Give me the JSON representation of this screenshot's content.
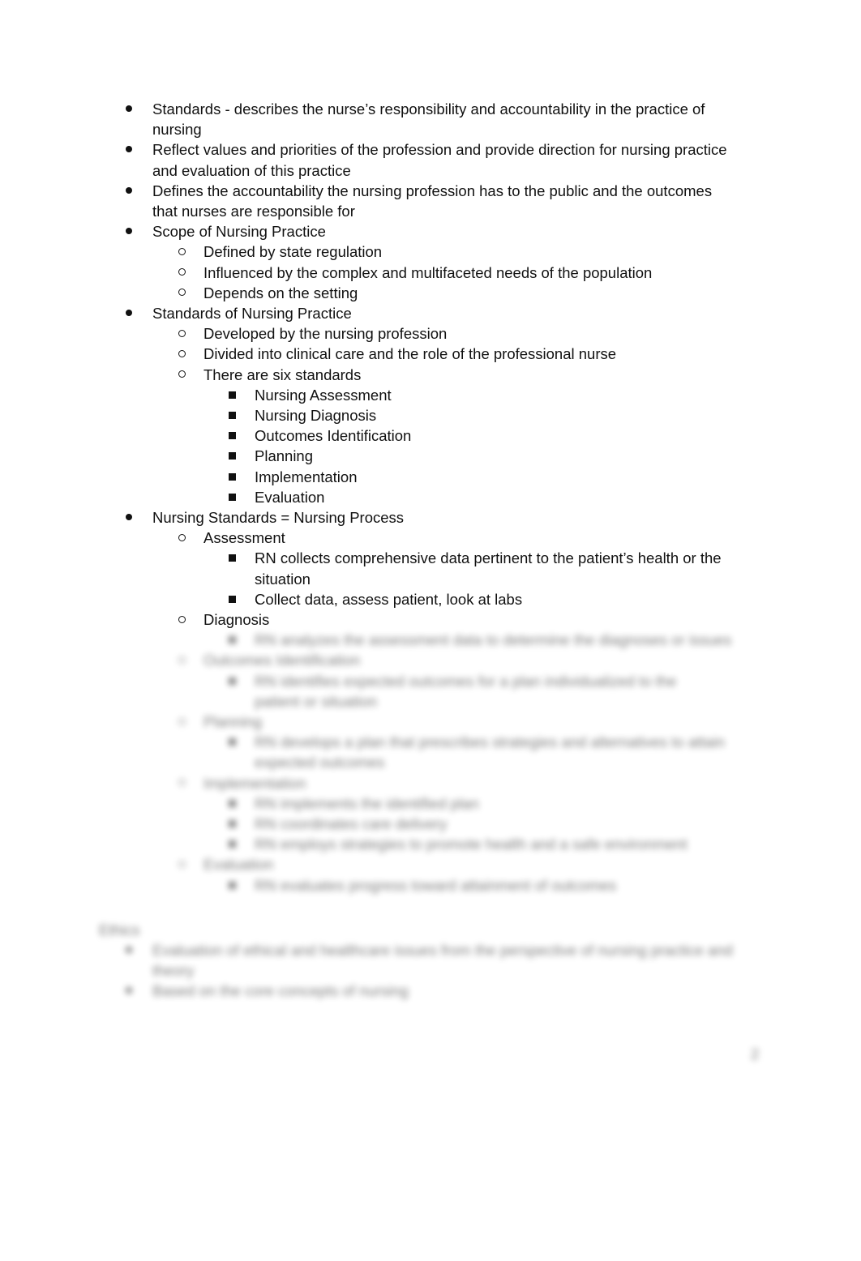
{
  "items": [
    {
      "level": 1,
      "lines": [
        "Standards - describes the nurse’s responsibility and accountability in the practice of",
        "nursing"
      ]
    },
    {
      "level": 1,
      "lines": [
        "Reflect values and priorities of the profession and provide direction for nursing practice",
        "and evaluation of this practice"
      ]
    },
    {
      "level": 1,
      "lines": [
        "Defines the accountability the nursing profession has to the public and the outcomes",
        "that nurses are responsible for"
      ]
    },
    {
      "level": 1,
      "lines": [
        "Scope of Nursing Practice"
      ]
    },
    {
      "level": 2,
      "lines": [
        "Defined by state regulation"
      ]
    },
    {
      "level": 2,
      "lines": [
        "Influenced by the complex and multifaceted needs of the population"
      ]
    },
    {
      "level": 2,
      "lines": [
        "Depends on the setting"
      ]
    },
    {
      "level": 1,
      "lines": [
        "Standards of Nursing Practice"
      ]
    },
    {
      "level": 2,
      "lines": [
        "Developed by the nursing profession"
      ]
    },
    {
      "level": 2,
      "lines": [
        "Divided into clinical care and the role of the professional nurse"
      ]
    },
    {
      "level": 2,
      "lines": [
        "There are six standards"
      ]
    },
    {
      "level": 3,
      "lines": [
        "Nursing Assessment"
      ]
    },
    {
      "level": 3,
      "lines": [
        "Nursing Diagnosis"
      ]
    },
    {
      "level": 3,
      "lines": [
        "Outcomes Identification"
      ]
    },
    {
      "level": 3,
      "lines": [
        "Planning"
      ]
    },
    {
      "level": 3,
      "lines": [
        "Implementation"
      ]
    },
    {
      "level": 3,
      "lines": [
        "Evaluation"
      ]
    },
    {
      "level": 1,
      "lines": [
        "Nursing Standards = Nursing Process"
      ]
    },
    {
      "level": 2,
      "lines": [
        "Assessment"
      ]
    },
    {
      "level": 3,
      "lines": [
        "RN collects comprehensive data pertinent to the patient’s health or the",
        "situation"
      ]
    },
    {
      "level": 3,
      "lines": [
        "Collect data, assess patient, look at labs"
      ]
    },
    {
      "level": 2,
      "lines": [
        "Diagnosis"
      ]
    }
  ],
  "blurred_items": [
    {
      "level": 3,
      "lines": [
        "RN analyzes the assessment data to determine the diagnoses or issues"
      ]
    },
    {
      "level": 2,
      "lines": [
        "Outcomes Identification"
      ]
    },
    {
      "level": 3,
      "lines": [
        "RN identifies expected outcomes for a plan individualized to the",
        "patient or situation"
      ]
    },
    {
      "level": 2,
      "lines": [
        "Planning"
      ]
    },
    {
      "level": 3,
      "lines": [
        "RN develops a plan that prescribes strategies and alternatives to attain",
        "expected outcomes"
      ]
    },
    {
      "level": 2,
      "lines": [
        "Implementation"
      ]
    },
    {
      "level": 3,
      "lines": [
        "RN implements the identified plan"
      ]
    },
    {
      "level": 3,
      "lines": [
        "RN coordinates care delivery"
      ]
    },
    {
      "level": 3,
      "lines": [
        "RN employs strategies to promote health and a safe environment"
      ]
    },
    {
      "level": 2,
      "lines": [
        "Evaluation"
      ]
    },
    {
      "level": 3,
      "lines": [
        "RN evaluates progress toward attainment of outcomes"
      ]
    }
  ],
  "blurred_section": {
    "heading": "Ethics",
    "items": [
      {
        "level": 1,
        "lines": [
          "Evaluation of ethical and healthcare issues from the perspective of nursing practice and",
          "theory"
        ]
      },
      {
        "level": 1,
        "lines": [
          "Based on the core concepts of nursing"
        ]
      }
    ]
  },
  "page_number": "2"
}
